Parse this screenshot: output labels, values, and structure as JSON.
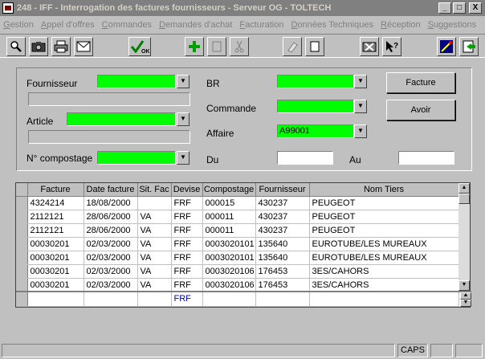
{
  "window": {
    "title": "248 - IFF - Interrogation des factures fournisseurs - Serveur OG - TOLTECH",
    "controls": [
      "_",
      "□",
      "X"
    ]
  },
  "menu": {
    "items": [
      {
        "first": "G",
        "rest": "estion"
      },
      {
        "first": "A",
        "rest": "ppel d'offres"
      },
      {
        "first": "C",
        "rest": "ommandes"
      },
      {
        "first": "D",
        "rest": "emandes d'achat"
      },
      {
        "first": "F",
        "rest": "acturation"
      },
      {
        "first": "D",
        "rest": "onnées Techniques"
      },
      {
        "first": "R",
        "rest": "éception"
      },
      {
        "first": "S",
        "rest": "uggestions"
      }
    ]
  },
  "toolbar": {
    "ok_label": "OK",
    "icons": [
      "magnifier-icon",
      "camera-icon",
      "printer-icon",
      "envelope-icon",
      "checkmark-ok-icon",
      "plus-icon",
      "blank-page-icon",
      "scissors-icon",
      "eraser-icon",
      "new-document-icon",
      "calculator-icon",
      "help-pointer-icon",
      "wizard-icon",
      "exit-icon"
    ]
  },
  "form": {
    "fournisseur_label": "Fournisseur",
    "article_label": "Article",
    "compostage_label": "N° compostage",
    "br_label": "BR",
    "commande_label": "Commande",
    "affaire_label": "Affaire",
    "affaire_value": "A99001",
    "du_label": "Du",
    "au_label": "Au",
    "facture_button": "Facture",
    "avoir_button": "Avoir"
  },
  "grid": {
    "columns": [
      "Facture",
      "Date facture",
      "Sit. Fac",
      "Devise",
      "Compostage",
      "Fournisseur",
      "Nom Tiers"
    ],
    "rows": [
      [
        "4324214",
        "18/08/2000",
        "",
        "FRF",
        "000015",
        "430237",
        "PEUGEOT"
      ],
      [
        "2112121",
        "28/06/2000",
        "VA",
        "FRF",
        "000011",
        "430237",
        "PEUGEOT"
      ],
      [
        "2112121",
        "28/06/2000",
        "VA",
        "FRF",
        "000011",
        "430237",
        "PEUGEOT"
      ],
      [
        "00030201",
        "02/03/2000",
        "VA",
        "FRF",
        "0003020101",
        "135640",
        "EUROTUBE/LES MUREAUX"
      ],
      [
        "00030201",
        "02/03/2000",
        "VA",
        "FRF",
        "0003020101",
        "135640",
        "EUROTUBE/LES MUREAUX"
      ],
      [
        "00030201",
        "02/03/2000",
        "VA",
        "FRF",
        "0003020106",
        "176453",
        "3ES/CAHORS"
      ],
      [
        "00030201",
        "02/03/2000",
        "VA",
        "FRF",
        "0003020106",
        "176453",
        "3ES/CAHORS"
      ]
    ],
    "new_row_devise": "FRF"
  },
  "status": {
    "caps": "CAPS"
  }
}
